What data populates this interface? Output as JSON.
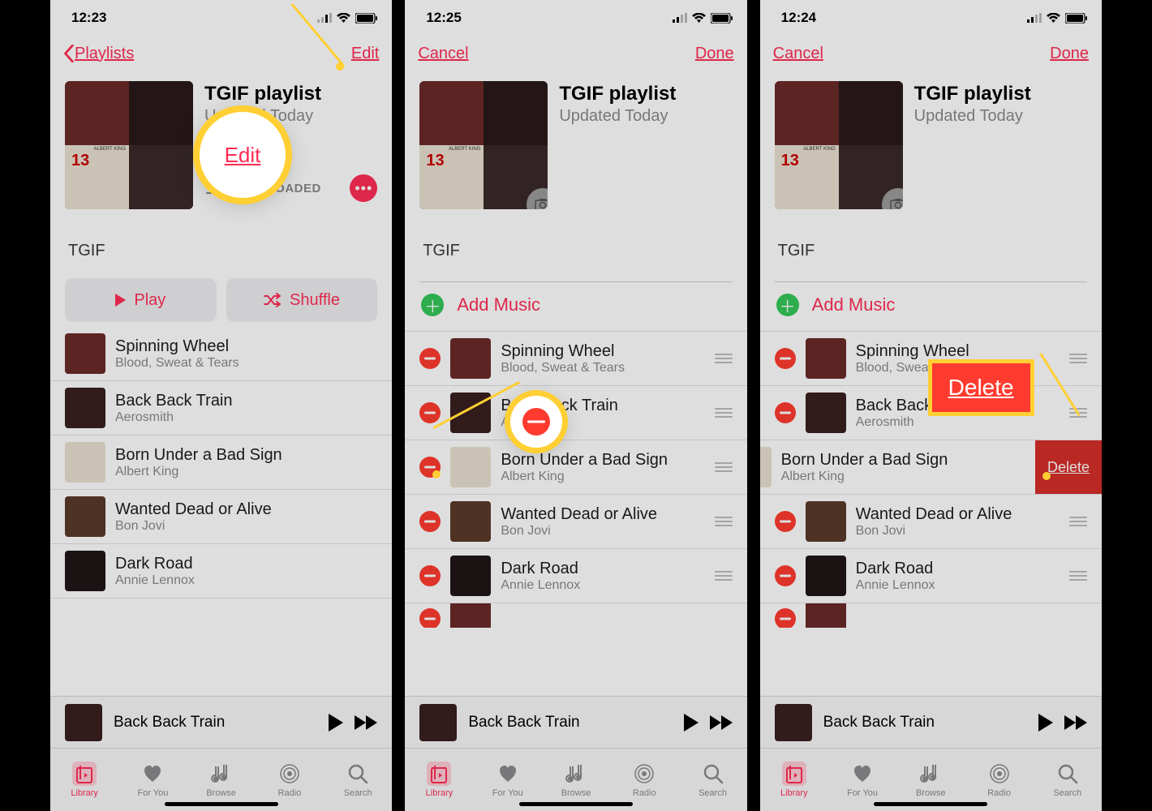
{
  "accent": "#ff2d55",
  "tracks": [
    {
      "title": "Spinning Wheel",
      "artist": "Blood, Sweat & Tears",
      "th": "th-a"
    },
    {
      "title": "Back Back Train",
      "artist": "Aerosmith",
      "th": "th-b"
    },
    {
      "title": "Born Under a Bad Sign",
      "artist": "Albert King",
      "th": "th-c"
    },
    {
      "title": "Wanted Dead or Alive",
      "artist": "Bon Jovi",
      "th": "th-d"
    },
    {
      "title": "Dark Road",
      "artist": "Annie Lennox",
      "th": "th-e"
    }
  ],
  "playlist": {
    "title": "TGIF playlist",
    "subtitle": "Updated Today",
    "desc": "TGIF",
    "downloaded": "DOWNLOADED"
  },
  "nav": {
    "back": "Playlists",
    "edit": "Edit",
    "cancel": "Cancel",
    "done": "Done"
  },
  "buttons": {
    "play": "Play",
    "shuffle": "Shuffle",
    "add": "Add Music",
    "delete": "Delete"
  },
  "nowplaying": "Back Back Train",
  "tabs": [
    "Library",
    "For You",
    "Browse",
    "Radio",
    "Search"
  ],
  "times": [
    "12:23",
    "12:25",
    "12:24"
  ],
  "callouts": {
    "edit": "Edit",
    "delete": "Delete"
  }
}
